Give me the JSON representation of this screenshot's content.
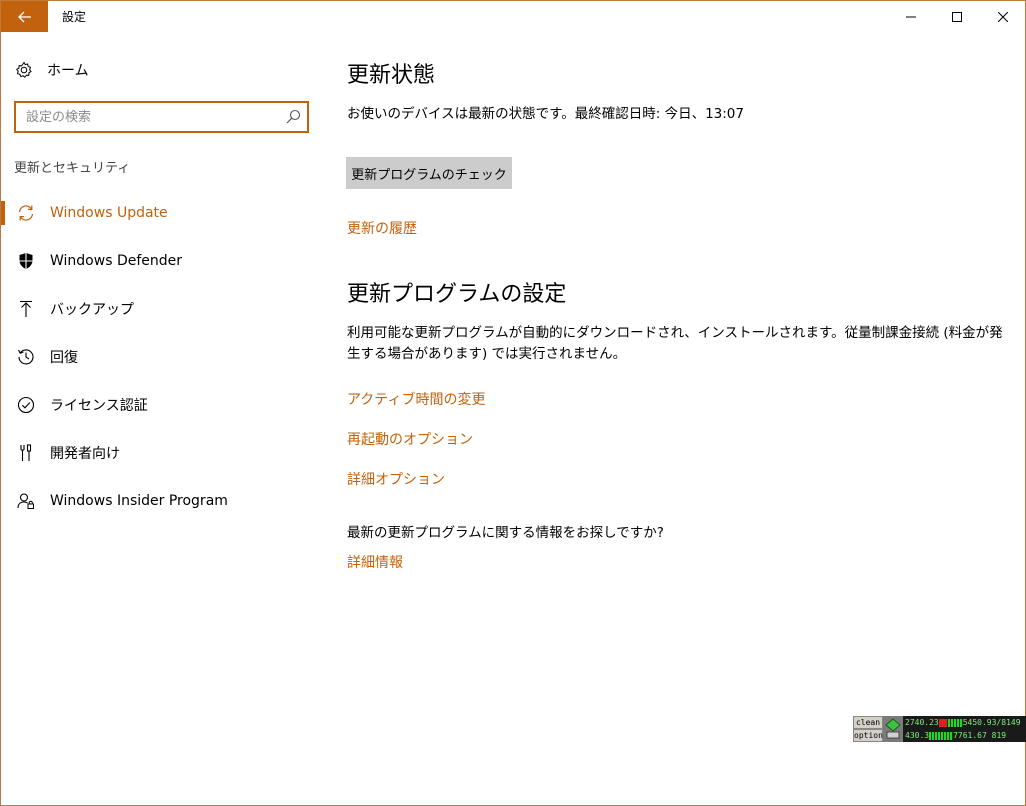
{
  "window": {
    "title": "設定",
    "controls": {
      "minimize": "minimize-icon",
      "maximize": "maximize-icon",
      "close": "close-icon"
    }
  },
  "sidebar": {
    "home_label": "ホーム",
    "search": {
      "placeholder": "設定の検索",
      "value": ""
    },
    "section_heading": "更新とセキュリティ",
    "items": [
      {
        "label": "Windows Update",
        "icon": "sync-icon",
        "active": true
      },
      {
        "label": "Windows Defender",
        "icon": "shield-icon",
        "active": false
      },
      {
        "label": "バックアップ",
        "icon": "upload-arrow-icon",
        "active": false
      },
      {
        "label": "回復",
        "icon": "history-icon",
        "active": false
      },
      {
        "label": "ライセンス認証",
        "icon": "check-circle-icon",
        "active": false
      },
      {
        "label": "開発者向け",
        "icon": "developer-tools-icon",
        "active": false
      },
      {
        "label": "Windows Insider Program",
        "icon": "insider-user-icon",
        "active": false
      }
    ]
  },
  "main": {
    "status": {
      "heading": "更新状態",
      "text": "お使いのデバイスは最新の状態です。最終確認日時: 今日、13:07",
      "check_button": "更新プログラムのチェック",
      "history_link": "更新の履歴"
    },
    "settings": {
      "heading": "更新プログラムの設定",
      "description": "利用可能な更新プログラムが自動的にダウンロードされ、インストールされます。従量制課金接続 (料金が発生する場合があります) では実行されません。",
      "links": [
        "アクティブ時間の変更",
        "再起動のオプション",
        "詳細オプション"
      ]
    },
    "info": {
      "question": "最新の更新プログラムに関する情報をお探しですか?",
      "link": "詳細情報"
    }
  },
  "system_widget": {
    "buttons": [
      "clean",
      "option"
    ],
    "row1_left": "2740.23",
    "row1_right": "5450.93/8149",
    "row2_left": "430.3",
    "row2_right": "7761.67 819"
  },
  "colors": {
    "accent": "#c2620d",
    "button_bg": "#cccccc",
    "border": "#c07a3a"
  }
}
